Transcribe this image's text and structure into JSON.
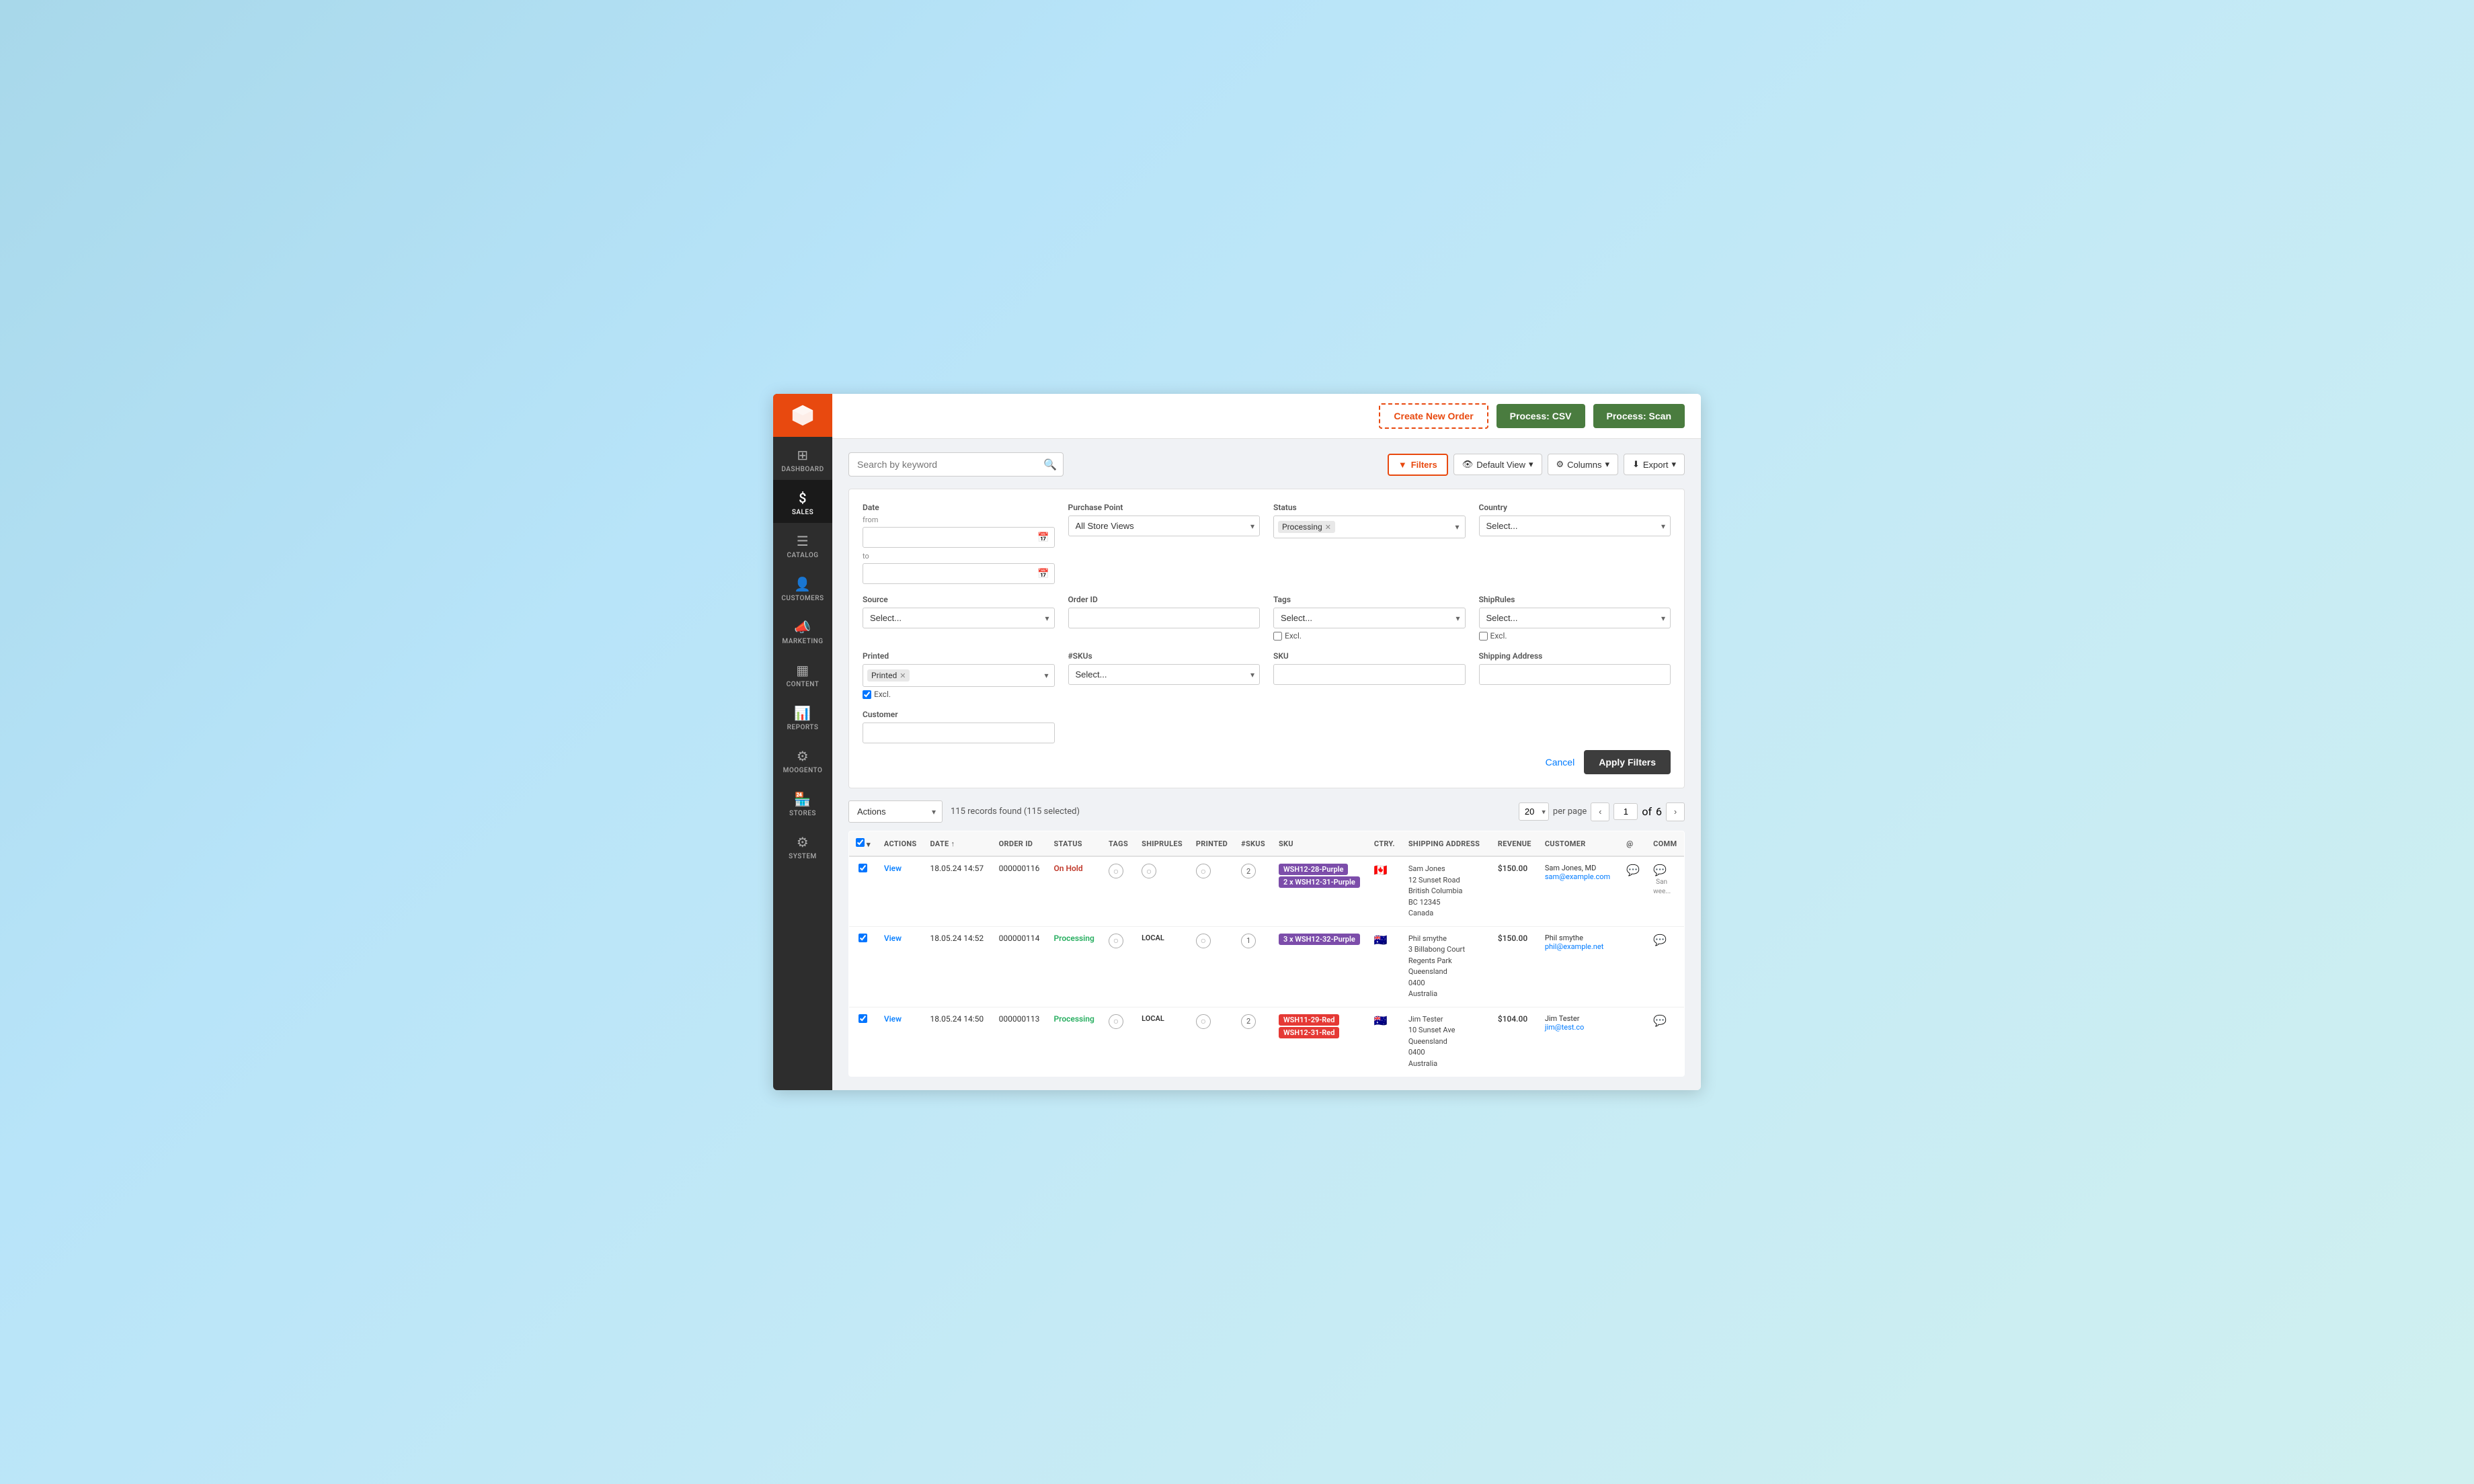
{
  "topbar": {
    "create_order_label": "Create New Order",
    "process_csv_label": "Process: CSV",
    "process_scan_label": "Process: Scan"
  },
  "sidebar": {
    "items": [
      {
        "id": "dashboard",
        "label": "DASHBOARD",
        "icon": "⊞"
      },
      {
        "id": "sales",
        "label": "SALES",
        "icon": "$",
        "active": true
      },
      {
        "id": "catalog",
        "label": "CATALOG",
        "icon": "☰"
      },
      {
        "id": "customers",
        "label": "CUSTOMERS",
        "icon": "👤"
      },
      {
        "id": "marketing",
        "label": "MARKETING",
        "icon": "📣"
      },
      {
        "id": "content",
        "label": "CONTENT",
        "icon": "▦"
      },
      {
        "id": "reports",
        "label": "REPORTS",
        "icon": "📊"
      },
      {
        "id": "moogento",
        "label": "MOOGENTO",
        "icon": "⚙"
      },
      {
        "id": "stores",
        "label": "STORES",
        "icon": "🏪"
      },
      {
        "id": "system",
        "label": "SYSTEM",
        "icon": "⚙"
      }
    ]
  },
  "search": {
    "placeholder": "Search by keyword"
  },
  "toolbar": {
    "filters_label": "Filters",
    "default_view_label": "Default View",
    "columns_label": "Columns",
    "export_label": "Export"
  },
  "filters": {
    "date_label": "Date",
    "date_from_label": "from",
    "date_to_label": "to",
    "purchase_point_label": "Purchase Point",
    "purchase_point_value": "All Store Views",
    "status_label": "Status",
    "status_tag": "Processing",
    "country_label": "Country",
    "country_placeholder": "Select...",
    "source_label": "Source",
    "source_placeholder": "Select...",
    "order_id_label": "Order ID",
    "tags_label": "Tags",
    "tags_placeholder": "Select...",
    "shiprules_label": "ShipRules",
    "shiprules_placeholder": "Select...",
    "printed_label": "Printed",
    "printed_tag": "Printed",
    "printed_excl": true,
    "skus_label": "#SKUs",
    "skus_placeholder": "Select...",
    "sku_label": "SKU",
    "shipping_address_label": "Shipping Address",
    "customer_label": "Customer",
    "tags_excl": false,
    "shiprules_excl": false,
    "cancel_label": "Cancel",
    "apply_label": "Apply Filters"
  },
  "table": {
    "actions_label": "Actions",
    "records_info": "115 records found (115 selected)",
    "per_page": "20",
    "page_current": "1",
    "page_total": "6",
    "per_page_label": "per page",
    "columns": [
      "",
      "ACTIONS",
      "DATE",
      "ORDER ID",
      "STATUS",
      "TAGS",
      "SHIPRULES",
      "PRINTED",
      "#SKUS",
      "SKU",
      "CTRY.",
      "SHIPPING ADDRESS",
      "REVENUE",
      "CUSTOMER",
      "@",
      "COMM"
    ],
    "rows": [
      {
        "checked": true,
        "view": "View",
        "date": "18.05.24 14:57",
        "order_id": "000000116",
        "status": "On Hold",
        "status_type": "hold",
        "tags": "",
        "shiprules": "",
        "printed": "",
        "skus_count": "2",
        "skus": [
          "WSH12-28-Purple",
          "WSH12-31-Purple"
        ],
        "sku_colors": [
          "purple",
          "purple"
        ],
        "sku_prefix": [
          "",
          "2 x"
        ],
        "ctry": "🇨🇦",
        "shipping_address": "Sam Jones\n12 Sunset Road\nBritish Columbia\nBC 12345\nCanada",
        "revenue": "$150.00",
        "customer_name": "Sam Jones, MD",
        "customer_email": "sam@example.com",
        "at": true,
        "comm": true,
        "comm_label": "San wee..."
      },
      {
        "checked": true,
        "view": "View",
        "date": "18.05.24 14:52",
        "order_id": "000000114",
        "status": "Processing",
        "status_type": "processing",
        "tags": "",
        "shiprules": "LOCAL",
        "printed": "",
        "skus_count": "1",
        "skus": [
          "WSH12-32-Purple"
        ],
        "sku_colors": [
          "purple"
        ],
        "sku_prefix": [
          "3 x"
        ],
        "ctry": "🇦🇺",
        "shipping_address": "Phil smythe\n3 Billabong Court Regents Park\nQueensland\n0400\nAustralia",
        "revenue": "$150.00",
        "customer_name": "Phil smythe",
        "customer_email": "phil@example.net",
        "at": false,
        "comm": true,
        "comm_label": ""
      },
      {
        "checked": true,
        "view": "View",
        "date": "18.05.24 14:50",
        "order_id": "000000113",
        "status": "Processing",
        "status_type": "processing",
        "tags": "",
        "shiprules": "LOCAL",
        "printed": "",
        "skus_count": "2",
        "skus": [
          "WSH11-29-Red",
          "WSH12-31-Red"
        ],
        "sku_colors": [
          "red",
          "red"
        ],
        "sku_prefix": [
          "",
          ""
        ],
        "ctry": "🇦🇺",
        "shipping_address": "Jim Tester\n10 Sunset Ave\nQueensland\n0400\nAustralia",
        "revenue": "$104.00",
        "customer_name": "Jim Tester",
        "customer_email": "jim@test.co",
        "at": false,
        "comm": true,
        "comm_label": ""
      }
    ]
  }
}
